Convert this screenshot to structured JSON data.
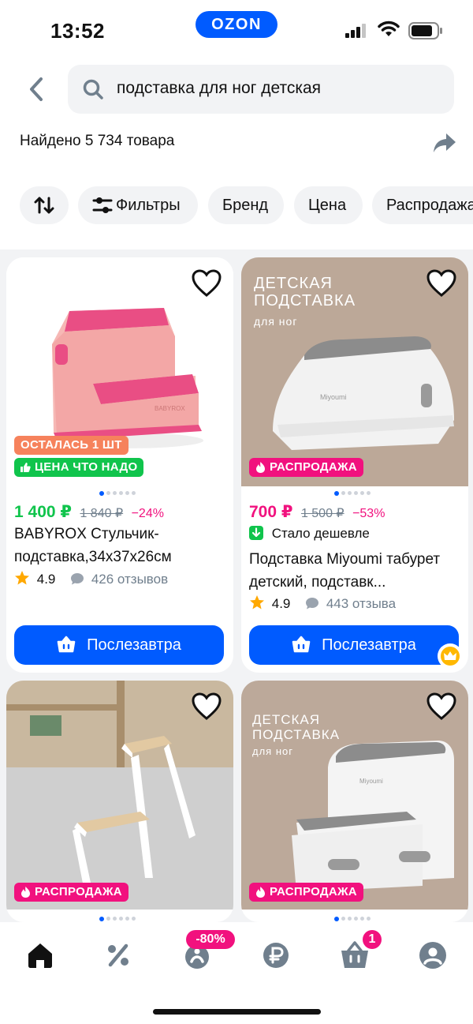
{
  "status": {
    "time": "13:52",
    "logo": "OZON"
  },
  "header": {
    "back_icon": "chevron-left-icon",
    "search_value": "подставка для ног детская",
    "found_text": "Найдено 5 734 товара",
    "share_icon": "share-arrow-icon"
  },
  "chips": {
    "sort_icon": "sort-arrows-icon",
    "filters": "Фильтры",
    "brand": "Бренд",
    "price": "Цена",
    "sale": "Распродажа"
  },
  "products": [
    {
      "badges": [
        "ОСТАЛАСЬ 1 ШТ",
        "ЦЕНА ЧТО НАДО"
      ],
      "price": "1 400 ₽",
      "old_price": "1 840 ₽",
      "discount": "−24%",
      "title": "BABYROX Стульчик-подставка,34x37x26см",
      "rating": "4.9",
      "reviews": "426 отзывов",
      "button": "Послезавтра"
    },
    {
      "image_text": [
        "ДЕТСКАЯ",
        "ПОДСТАВКА",
        "для ног"
      ],
      "badges": [
        "РАСПРОДАЖА"
      ],
      "price": "700 ₽",
      "old_price": "1 500 ₽",
      "discount": "−53%",
      "cheaper": "Стало дешевле",
      "title": "Подставка Miyoumi табурет детский, подставк...",
      "rating": "4.9",
      "reviews": "443 отзыва",
      "button": "Послезавтра"
    },
    {
      "badges": [
        "РАСПРОДАЖА"
      ]
    },
    {
      "image_text": [
        "ДЕТСКАЯ",
        "ПОДСТАВКА",
        "для ног"
      ],
      "badges": [
        "РАСПРОДАЖА"
      ]
    }
  ],
  "bottom_nav": {
    "items": [
      "home-icon",
      "percent-icon",
      "fresh-icon",
      "ruble-icon",
      "cart-icon",
      "profile-icon"
    ],
    "fresh_badge": "-80%",
    "cart_badge": "1"
  },
  "colors": {
    "accent": "#005bff",
    "sale": "#f1117e",
    "green": "#10c44c"
  }
}
